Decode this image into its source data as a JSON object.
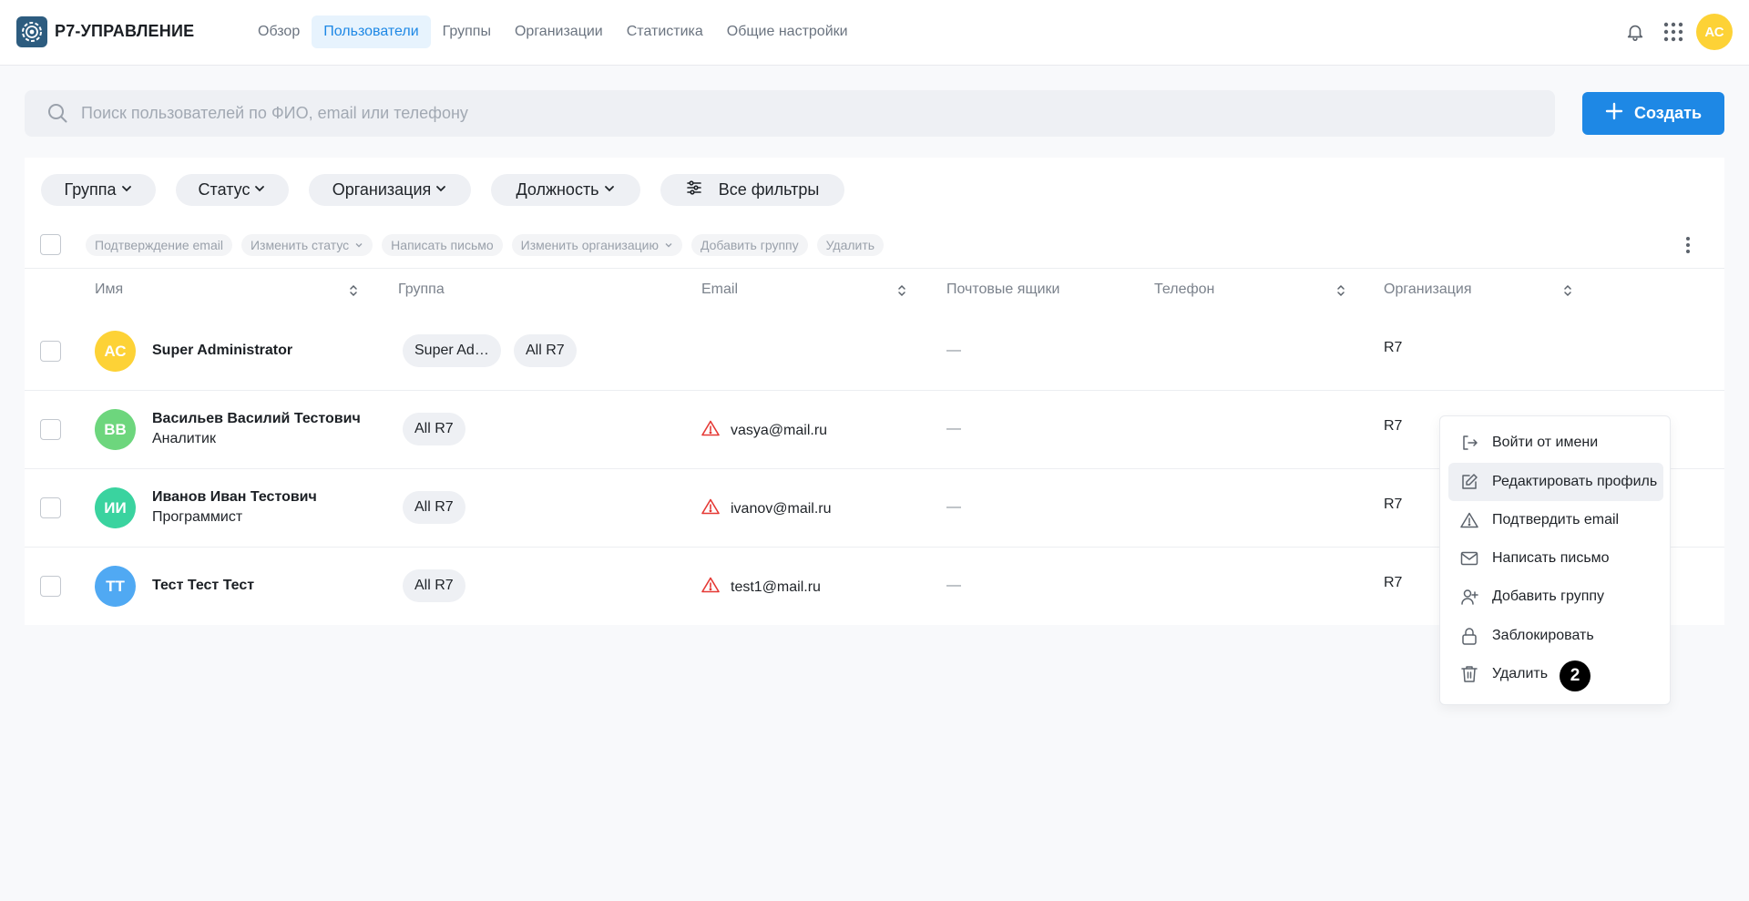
{
  "app": {
    "title": "Р7-УПРАВЛЕНИЕ"
  },
  "nav": {
    "items": [
      {
        "label": "Обзор",
        "active": false
      },
      {
        "label": "Пользователи",
        "active": true
      },
      {
        "label": "Группы",
        "active": false
      },
      {
        "label": "Организации",
        "active": false
      },
      {
        "label": "Статистика",
        "active": false
      },
      {
        "label": "Общие настройки",
        "active": false
      }
    ]
  },
  "header": {
    "avatar_initials": "АС",
    "icons": [
      "bell-icon",
      "apps-grid-icon"
    ]
  },
  "search": {
    "placeholder": "Поиск пользователей по ФИО, email или телефону",
    "value": ""
  },
  "create_button": {
    "label": "Создать"
  },
  "filters": {
    "group": "Группа",
    "status": "Статус",
    "organization": "Организация",
    "position": "Должность",
    "all": "Все фильтры"
  },
  "bulk_actions": {
    "confirm_email": "Подтверждение email",
    "change_status": "Изменить статус",
    "write_letter": "Написать письмо",
    "change_org": "Изменить организацию",
    "add_group": "Добавить группу",
    "delete": "Удалить"
  },
  "table": {
    "columns": {
      "name": "Имя",
      "group": "Группа",
      "email": "Email",
      "mailboxes": "Почтовые ящики",
      "phone": "Телефон",
      "organization": "Организация"
    },
    "rows": [
      {
        "initials": "АС",
        "avatar_color": "#fdd236",
        "name": "Super Administrator",
        "position": "",
        "groups": [
          "Super Ad…",
          "All R7"
        ],
        "email": "",
        "mailboxes": "—",
        "phone": "",
        "organization": "R7"
      },
      {
        "initials": "ВВ",
        "avatar_color": "#6dd67d",
        "name": "Васильев Василий Тестович",
        "position": "Аналитик",
        "groups": [
          "All R7"
        ],
        "email": "vasya@mail.ru",
        "mailboxes": "—",
        "phone": "",
        "organization": "R7"
      },
      {
        "initials": "ИИ",
        "avatar_color": "#3ad39f",
        "name": "Иванов Иван Тестович",
        "position": "Программист",
        "groups": [
          "All R7"
        ],
        "email": "ivanov@mail.ru",
        "mailboxes": "—",
        "phone": "",
        "organization": "R7"
      },
      {
        "initials": "ТТ",
        "avatar_color": "#50a9f3",
        "name": "Тест Тест Тест",
        "position": "",
        "groups": [
          "All R7"
        ],
        "email": "test1@mail.ru",
        "mailboxes": "—",
        "phone": "",
        "organization": "R7"
      }
    ]
  },
  "context_menu": {
    "items": [
      {
        "label": "Войти от имени",
        "icon": "login-as-icon"
      },
      {
        "label": "Редактировать профиль",
        "icon": "edit-icon",
        "highlighted": true
      },
      {
        "label": "Подтвердить email",
        "icon": "warning-icon"
      },
      {
        "label": "Написать письмо",
        "icon": "mail-icon"
      },
      {
        "label": "Добавить группу",
        "icon": "user-plus-icon"
      },
      {
        "label": "Заблокировать",
        "icon": "lock-icon"
      },
      {
        "label": "Удалить",
        "icon": "trash-icon"
      }
    ],
    "badge": "2"
  },
  "colors": {
    "accent": "#1e88e5",
    "warning": "#e53935"
  }
}
